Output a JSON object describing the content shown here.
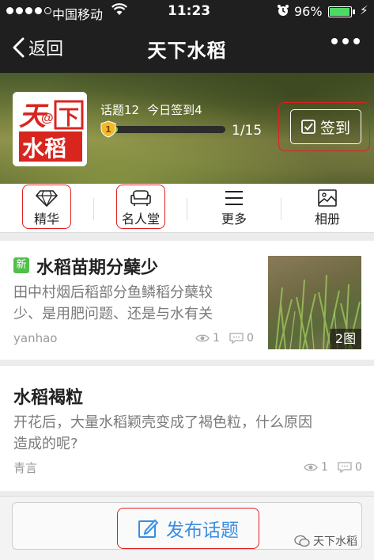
{
  "status_bar": {
    "carrier": "中国移动",
    "time": "11:23",
    "battery_percent": "96%",
    "battery_level": 0.96,
    "signal_bars_filled": 4,
    "signal_bars_total": 5
  },
  "nav": {
    "back_label": "返回",
    "title": "天下水稻",
    "more_icon": "ellipsis-icon"
  },
  "group": {
    "logo_text_top": "天@下",
    "logo_text_bottom": "水稻",
    "topics_label": "话题12",
    "checkins_label": "今日签到4",
    "level": "1",
    "progress_value": 1,
    "progress_max": 15,
    "progress_text": "1/15",
    "checkin_label": "签到"
  },
  "tabs": [
    {
      "label": "精华",
      "icon": "diamond-icon"
    },
    {
      "label": "名人堂",
      "icon": "sofa-icon"
    },
    {
      "label": "更多",
      "icon": "menu-icon"
    },
    {
      "label": "相册",
      "icon": "image-icon"
    }
  ],
  "posts": [
    {
      "badge": "新",
      "title": "水稻苗期分蘖少",
      "body_line1": "田中村烟后稻部分鱼鳞稻分蘖较",
      "body_line2": "少、是用肥问题、还是与水有关",
      "author": "yanhao",
      "views": "1",
      "comments": "0",
      "image_count": "2图"
    },
    {
      "title": "水稻褐粒",
      "body_line1": "开花后，大量水稻颖壳变成了褐色粒，什么原因",
      "body_line2": "造成的呢?",
      "author": "青言",
      "views": "1",
      "comments": "0"
    }
  ],
  "bottom": {
    "publish_label": "发布话题",
    "watermark": "天下水稻"
  },
  "colors": {
    "highlight": "#e02020",
    "accent_blue": "#3a8ee0",
    "new_badge": "#4fc04a",
    "progress": "#8ac43a"
  }
}
